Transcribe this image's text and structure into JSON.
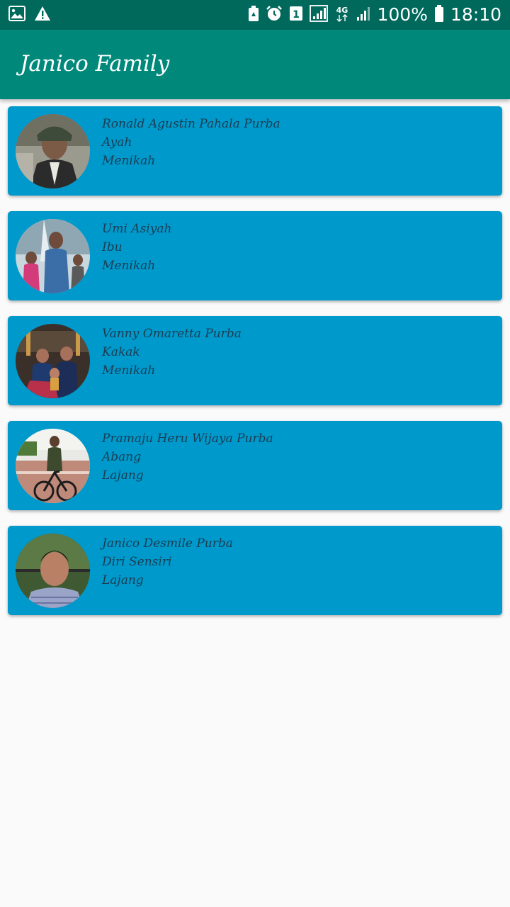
{
  "status_bar": {
    "battery": "100%",
    "time": "18:10",
    "network": "4G",
    "sim_slot": "1",
    "icons": [
      "image-icon",
      "warning-icon",
      "battery-saver-icon",
      "alarm-icon",
      "sim-1-icon",
      "signal-icon",
      "network-4g-icon",
      "signal-icon",
      "battery-icon"
    ]
  },
  "app_bar": {
    "title": "Janico Family",
    "color": "#00897b"
  },
  "colors": {
    "status_bar": "#00695c",
    "card": "#0099cc",
    "card_text": "#1c3d52",
    "background": "#fafafa"
  },
  "members": [
    {
      "name": "Ronald Agustin Pahala Purba",
      "role": "Ayah",
      "status": "Menikah",
      "avatar": "avatar-photo-father"
    },
    {
      "name": "Umi Asiyah",
      "role": "Ibu",
      "status": "Menikah",
      "avatar": "avatar-photo-mother"
    },
    {
      "name": "Vanny Omaretta Purba",
      "role": "Kakak",
      "status": "Menikah",
      "avatar": "avatar-photo-sister"
    },
    {
      "name": "Pramaju Heru Wijaya Purba",
      "role": "Abang",
      "status": "Lajang",
      "avatar": "avatar-photo-brother"
    },
    {
      "name": "Janico Desmile Purba",
      "role": "Diri Sensiri",
      "status": "Lajang",
      "avatar": "avatar-photo-self"
    }
  ]
}
